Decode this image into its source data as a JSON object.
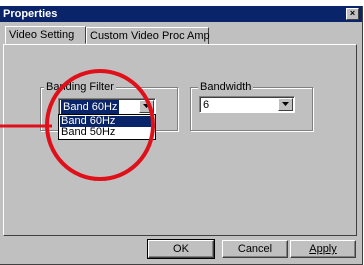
{
  "window": {
    "title": "Properties",
    "close_glyph": "×"
  },
  "tabs": [
    {
      "label": "Video Setting",
      "active": true
    },
    {
      "label": "Custom Video Proc Amp",
      "active": false
    }
  ],
  "banding": {
    "group_label": "Banding Filter",
    "selected": "Band 60Hz",
    "options": [
      "Band 60Hz",
      "Band 50Hz"
    ],
    "highlighted_index": 0
  },
  "bandwidth": {
    "group_label": "Bandwidth",
    "selected": "6"
  },
  "buttons": {
    "ok": "OK",
    "cancel": "Cancel",
    "apply": "Apply"
  },
  "annotation": {
    "color": "#e0101a",
    "icon": "red-circle-highlight"
  }
}
